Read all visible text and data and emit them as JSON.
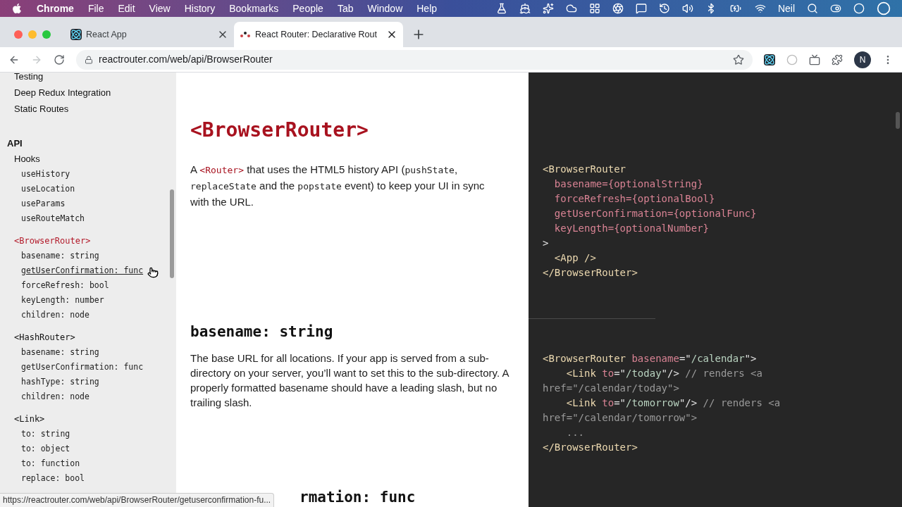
{
  "menu_bar": {
    "app": "Chrome",
    "menus": [
      "File",
      "Edit",
      "View",
      "History",
      "Bookmarks",
      "People",
      "Tab",
      "Window",
      "Help"
    ],
    "user": "Neil"
  },
  "tabs": [
    {
      "title": "React App",
      "selected": false
    },
    {
      "title": "React Router: Declarative Rout",
      "selected": true
    }
  ],
  "address_bar": {
    "url": "reactrouter.com/web/api/BrowserRouter"
  },
  "profile": {
    "initial": "N"
  },
  "sidebar": {
    "items": [
      {
        "label": "Testing"
      },
      {
        "label": "Deep Redux Integration"
      },
      {
        "label": "Static Routes"
      }
    ],
    "sections": [
      {
        "label": "API",
        "children": [
          {
            "label": "Hooks",
            "kind": "text",
            "selected": false,
            "children": [
              {
                "label": "useHistory",
                "hovered": false
              },
              {
                "label": "useLocation",
                "hovered": false
              },
              {
                "label": "useParams",
                "hovered": false
              },
              {
                "label": "useRouteMatch",
                "hovered": false
              }
            ]
          },
          {
            "label": "<BrowserRouter>",
            "kind": "code",
            "selected": true,
            "children": [
              {
                "label": "basename: string",
                "hovered": false
              },
              {
                "label": "getUserConfirmation: func",
                "hovered": true
              },
              {
                "label": "forceRefresh: bool",
                "hovered": false
              },
              {
                "label": "keyLength: number",
                "hovered": false
              },
              {
                "label": "children: node",
                "hovered": false
              }
            ]
          },
          {
            "label": "<HashRouter>",
            "kind": "code",
            "selected": false,
            "children": [
              {
                "label": "basename: string",
                "hovered": false
              },
              {
                "label": "getUserConfirmation: func",
                "hovered": false
              },
              {
                "label": "hashType: string",
                "hovered": false
              },
              {
                "label": "children: node",
                "hovered": false
              }
            ]
          },
          {
            "label": "<Link>",
            "kind": "code",
            "selected": false,
            "children": [
              {
                "label": "to: string",
                "hovered": false
              },
              {
                "label": "to: object",
                "hovered": false
              },
              {
                "label": "to: function",
                "hovered": false
              },
              {
                "label": "replace: bool",
                "hovered": false
              }
            ]
          }
        ]
      }
    ]
  },
  "content": {
    "title": "<BrowserRouter>",
    "intro": [
      {
        "kind": "text",
        "text": "A "
      },
      {
        "kind": "link",
        "text": "<Router>"
      },
      {
        "kind": "text",
        "text": " that uses the HTML5 history API ("
      },
      {
        "kind": "code",
        "text": "pushState"
      },
      {
        "kind": "text",
        "text": ", "
      },
      {
        "kind": "code",
        "text": "replaceState"
      },
      {
        "kind": "text",
        "text": " and the "
      },
      {
        "kind": "code",
        "text": "popstate"
      },
      {
        "kind": "text",
        "text": " event) to keep your UI in sync with the URL."
      }
    ],
    "section_title": "basename: string",
    "section_text": "The base URL for all locations. If your app is served from a sub-directory on your server, you’ll want to set this to the sub-directory. A properly formatted basename should have a leading slash, but no trailing slash.",
    "next_title": "rmation: func"
  },
  "code_blocks": [
    [
      [
        {
          "kind": "tag",
          "text": "<BrowserRouter"
        }
      ],
      [
        {
          "kind": "attr",
          "text": "  basename={optionalString}"
        }
      ],
      [
        {
          "kind": "attr",
          "text": "  forceRefresh={optionalBool}"
        }
      ],
      [
        {
          "kind": "attr",
          "text": "  getUserConfirmation={optionalFunc}"
        }
      ],
      [
        {
          "kind": "attr",
          "text": "  keyLength={optionalNumber}"
        }
      ],
      [
        {
          "kind": "plain",
          "text": ">"
        }
      ],
      [
        {
          "kind": "tag",
          "text": "  <App />"
        }
      ],
      [
        {
          "kind": "tag",
          "text": "</BrowserRouter>"
        }
      ]
    ],
    [
      [
        {
          "kind": "tag",
          "text": "<BrowserRouter "
        },
        {
          "kind": "attr",
          "text": "basename"
        },
        {
          "kind": "plain",
          "text": "=\""
        },
        {
          "kind": "string",
          "text": "/calendar"
        },
        {
          "kind": "plain",
          "text": "\">"
        }
      ],
      [
        {
          "kind": "tag",
          "text": "    <Link "
        },
        {
          "kind": "attr",
          "text": "to"
        },
        {
          "kind": "plain",
          "text": "=\""
        },
        {
          "kind": "string",
          "text": "/today"
        },
        {
          "kind": "plain",
          "text": "\"/>"
        },
        {
          "kind": "comment",
          "text": " // renders <a"
        }
      ],
      [
        {
          "kind": "comment",
          "text": "href=\"/calendar/today\">"
        }
      ],
      [
        {
          "kind": "tag",
          "text": "    <Link "
        },
        {
          "kind": "attr",
          "text": "to"
        },
        {
          "kind": "plain",
          "text": "=\""
        },
        {
          "kind": "string",
          "text": "/tomorrow"
        },
        {
          "kind": "plain",
          "text": "\"/>"
        },
        {
          "kind": "comment",
          "text": " // renders <a"
        }
      ],
      [
        {
          "kind": "comment",
          "text": "href=\"/calendar/tomorrow\">"
        }
      ],
      [
        {
          "kind": "comment",
          "text": "    ..."
        }
      ],
      [
        {
          "kind": "tag",
          "text": "</BrowserRouter>"
        }
      ]
    ]
  ],
  "status_url": "https://reactrouter.com/web/api/BrowserRouter/getuserconfirmation-fu..."
}
